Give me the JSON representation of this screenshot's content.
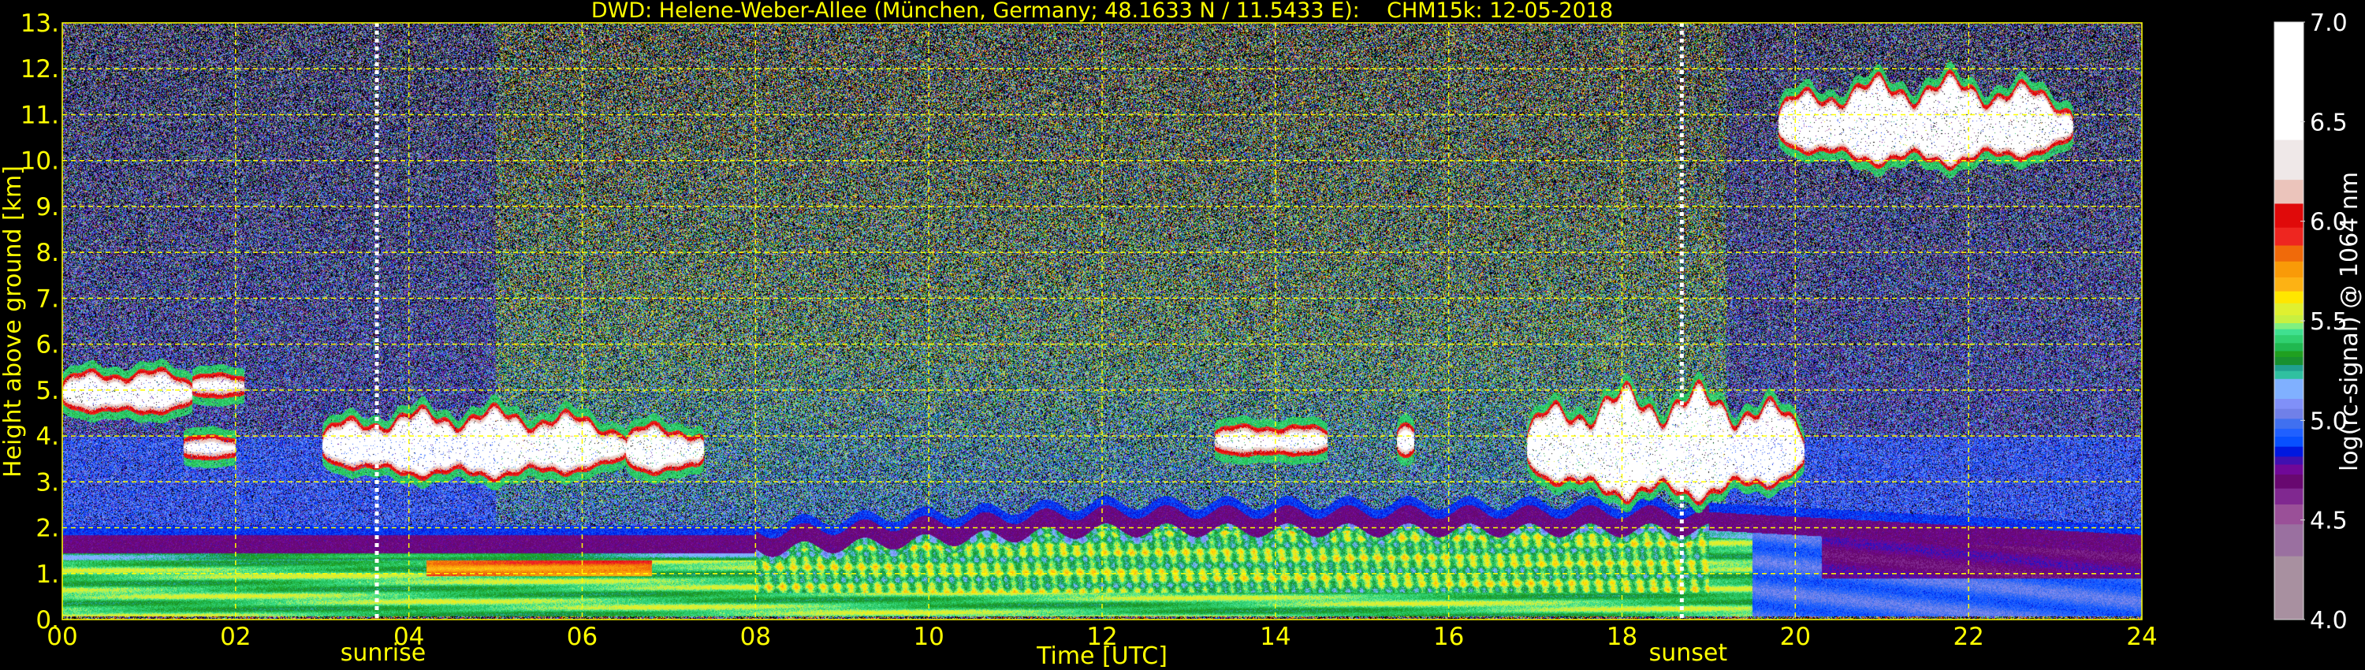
{
  "chart_data": {
    "type": "heatmap",
    "title": "DWD: Helene-Weber-Allee (München, Germany; 48.1633 N / 11.5433 E):    CHM15k: 12-05-2018",
    "xlabel": "Time [UTC]",
    "ylabel": "Height above ground [km]",
    "xlim": [
      0,
      24
    ],
    "ylim": [
      0,
      13
    ],
    "x_ticks": [
      0,
      2,
      4,
      6,
      8,
      10,
      12,
      14,
      16,
      18,
      20,
      22,
      24
    ],
    "x_tick_labels": [
      "00",
      "02",
      "04",
      "06",
      "08",
      "10",
      "12",
      "14",
      "16",
      "18",
      "20",
      "22",
      "24"
    ],
    "y_ticks": [
      0,
      1,
      2,
      3,
      4,
      5,
      6,
      7,
      8,
      9,
      10,
      11,
      12,
      13
    ],
    "y_tick_labels": [
      "0.",
      "1.",
      "2.",
      "3.",
      "4.",
      "5.",
      "6.",
      "7.",
      "8.",
      "9.",
      "10.",
      "11.",
      "12.",
      "13."
    ],
    "grid": true,
    "grid_color": "#ffff00",
    "annotations": [
      {
        "label": "sunrise",
        "time_h": 3.63
      },
      {
        "label": "sunset",
        "time_h": 18.69
      }
    ],
    "colorbar": {
      "label": "log(rc-signal) @ 1064 nm",
      "range": [
        4.0,
        7.0
      ],
      "ticks": [
        4.0,
        4.5,
        5.0,
        5.5,
        6.0,
        6.5,
        7.0
      ],
      "tick_labels": [
        "4.0",
        "4.5",
        "5.0",
        "5.5",
        "6.0",
        "6.5",
        "7.0"
      ],
      "levels": [
        {
          "from": 4.0,
          "to": 4.32,
          "color": "#a890a0"
        },
        {
          "from": 4.32,
          "to": 4.48,
          "color": "#9a70a0"
        },
        {
          "from": 4.48,
          "to": 4.58,
          "color": "#9a5098"
        },
        {
          "from": 4.58,
          "to": 4.66,
          "color": "#802890"
        },
        {
          "from": 4.66,
          "to": 4.73,
          "color": "#680870"
        },
        {
          "from": 4.73,
          "to": 4.78,
          "color": "#700898"
        },
        {
          "from": 4.78,
          "to": 4.82,
          "color": "#4010b0"
        },
        {
          "from": 4.82,
          "to": 4.87,
          "color": "#0018e0"
        },
        {
          "from": 4.87,
          "to": 4.92,
          "color": "#0850ff"
        },
        {
          "from": 4.92,
          "to": 4.96,
          "color": "#2060ff"
        },
        {
          "from": 4.96,
          "to": 5.01,
          "color": "#4070f0"
        },
        {
          "from": 5.01,
          "to": 5.06,
          "color": "#7080e8"
        },
        {
          "from": 5.06,
          "to": 5.11,
          "color": "#8090f8"
        },
        {
          "from": 5.11,
          "to": 5.21,
          "color": "#80b0ff"
        },
        {
          "from": 5.21,
          "to": 5.25,
          "color": "#30c0a0"
        },
        {
          "from": 5.25,
          "to": 5.28,
          "color": "#20a090"
        },
        {
          "from": 5.28,
          "to": 5.32,
          "color": "#189030"
        },
        {
          "from": 5.32,
          "to": 5.35,
          "color": "#20a020"
        },
        {
          "from": 5.35,
          "to": 5.39,
          "color": "#20b850"
        },
        {
          "from": 5.39,
          "to": 5.43,
          "color": "#30d070"
        },
        {
          "from": 5.43,
          "to": 5.46,
          "color": "#40e090"
        },
        {
          "from": 5.46,
          "to": 5.49,
          "color": "#80f080"
        },
        {
          "from": 5.49,
          "to": 5.53,
          "color": "#c8f040"
        },
        {
          "from": 5.53,
          "to": 5.59,
          "color": "#e0f030"
        },
        {
          "from": 5.59,
          "to": 5.65,
          "color": "#ffe600"
        },
        {
          "from": 5.65,
          "to": 5.72,
          "color": "#fdb214"
        },
        {
          "from": 5.72,
          "to": 5.8,
          "color": "#f99a08"
        },
        {
          "from": 5.8,
          "to": 5.88,
          "color": "#f06a0a"
        },
        {
          "from": 5.88,
          "to": 5.97,
          "color": "#ee2620"
        },
        {
          "from": 5.97,
          "to": 6.09,
          "color": "#e00a0a"
        },
        {
          "from": 6.09,
          "to": 6.21,
          "color": "#ebc4bb"
        },
        {
          "from": 6.21,
          "to": 6.41,
          "color": "#efe8e8"
        },
        {
          "from": 6.41,
          "to": 7.0,
          "color": "#ffffff"
        }
      ]
    },
    "cloud_layers": [
      {
        "t_start": 0.0,
        "t_end": 1.5,
        "base_km": 4.6,
        "top_km": 5.3
      },
      {
        "t_start": 1.5,
        "t_end": 2.1,
        "base_km": 5.0,
        "top_km": 5.2
      },
      {
        "t_start": 1.4,
        "t_end": 2.0,
        "base_km": 3.65,
        "top_km": 3.85
      },
      {
        "t_start": 3.0,
        "t_end": 6.5,
        "base_km": 3.2,
        "top_km": 4.4
      },
      {
        "t_start": 6.5,
        "t_end": 7.4,
        "base_km": 3.3,
        "top_km": 4.1
      },
      {
        "t_start": 13.3,
        "t_end": 14.6,
        "base_km": 3.7,
        "top_km": 4.1
      },
      {
        "t_start": 15.4,
        "t_end": 15.6,
        "base_km": 3.7,
        "top_km": 4.1
      },
      {
        "t_start": 16.9,
        "t_end": 20.1,
        "base_km": 2.7,
        "top_km": 4.8
      },
      {
        "t_start": 19.8,
        "t_end": 23.2,
        "base_km": 10.0,
        "top_km": 11.6
      }
    ]
  }
}
